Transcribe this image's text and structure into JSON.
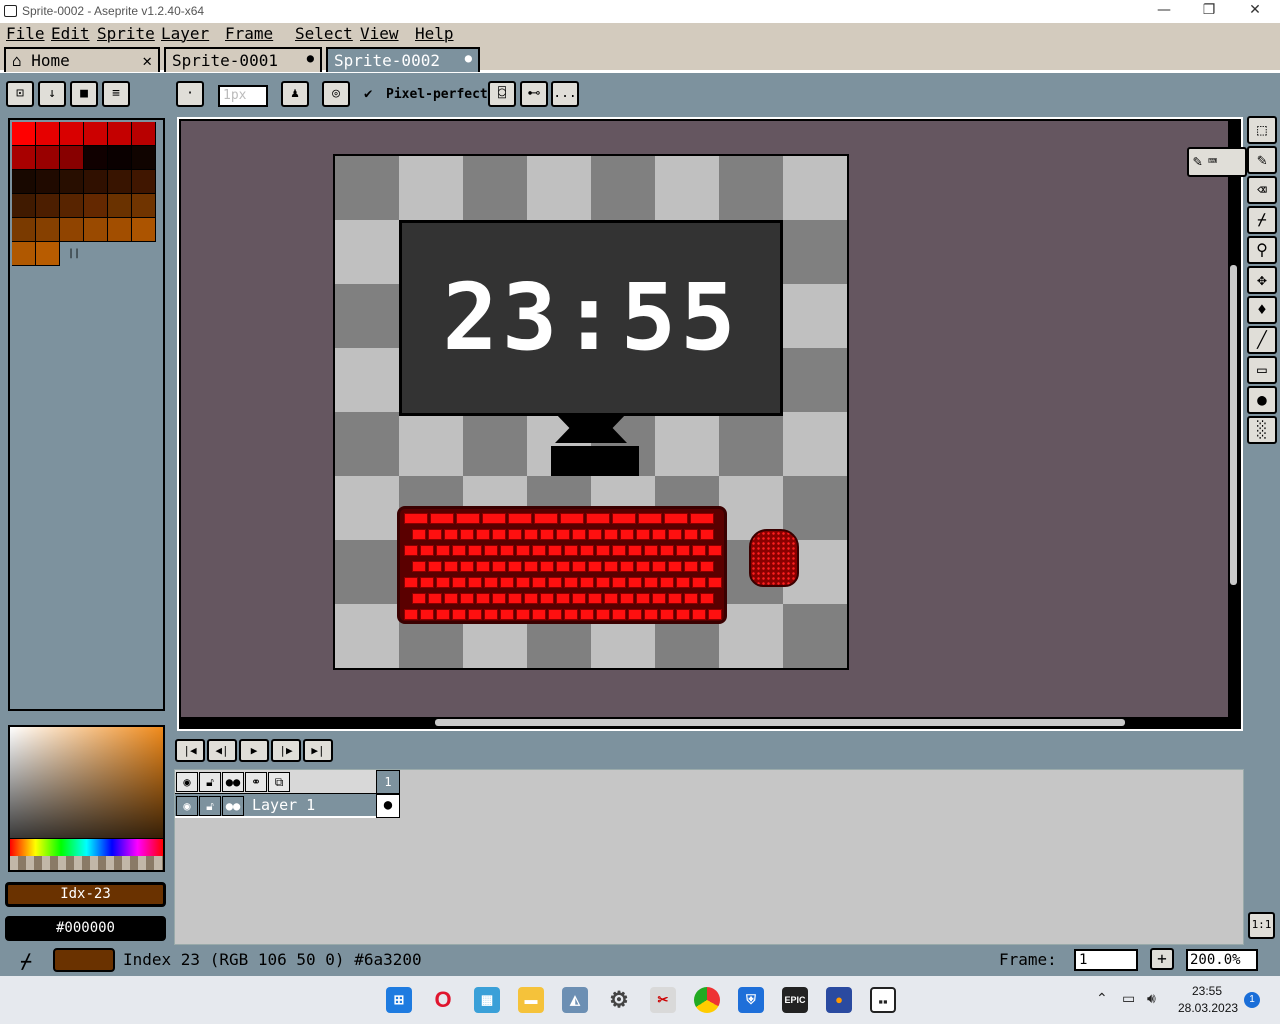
{
  "window": {
    "title": "Sprite-0002 - Aseprite v1.2.40-x64",
    "minimize": "—",
    "maximize": "❐",
    "close": "✕"
  },
  "menu": [
    "File",
    "Edit",
    "Sprite",
    "Layer",
    "Frame",
    "Select",
    "View",
    "Help"
  ],
  "tabs": [
    {
      "label": "Home",
      "close": "✕"
    },
    {
      "label": "Sprite-0001",
      "close": "●"
    },
    {
      "label": "Sprite-0002",
      "close": "●"
    }
  ],
  "toolbar": {
    "brush_size": "1px",
    "pixel_perfect_label": "Pixel-perfect",
    "more": "..."
  },
  "palette": {
    "colors": [
      "#ff0000",
      "#e60000",
      "#d90000",
      "#cc0000",
      "#c40000",
      "#b80000",
      "#a80000",
      "#990000",
      "#880000",
      "#100000",
      "#0a0000",
      "#100400",
      "#180800",
      "#200a00",
      "#280e00",
      "#301000",
      "#381400",
      "#401600",
      "#401a00",
      "#4c1e00",
      "#582400",
      "#642800",
      "#6a3200",
      "#703400",
      "#7a3a00",
      "#864000",
      "#904400",
      "#9a4a00",
      "#a24e00",
      "#ac5400",
      "#b05800",
      "#b85c00"
    ]
  },
  "sprite": {
    "clock_text": "23:55",
    "checker_dark": "#808080",
    "checker_light": "#c0c0c0"
  },
  "colors": {
    "foreground_label": "Idx-23",
    "foreground_color": "#6a3200",
    "background_label": "#000000",
    "background_color": "#000000"
  },
  "timeline": {
    "frame_number": "1",
    "layer_name": "Layer 1"
  },
  "status": {
    "info": "Index 23 (RGB 106 50 0) #6a3200",
    "frame_label": "Frame:",
    "frame_value": "1",
    "add_frame": "+",
    "zoom": "200.0%"
  },
  "tools_side": {
    "one_to_one": "1:1"
  },
  "taskbar": {
    "time": "23:55",
    "date": "28.03.2023",
    "notifications": "1"
  }
}
